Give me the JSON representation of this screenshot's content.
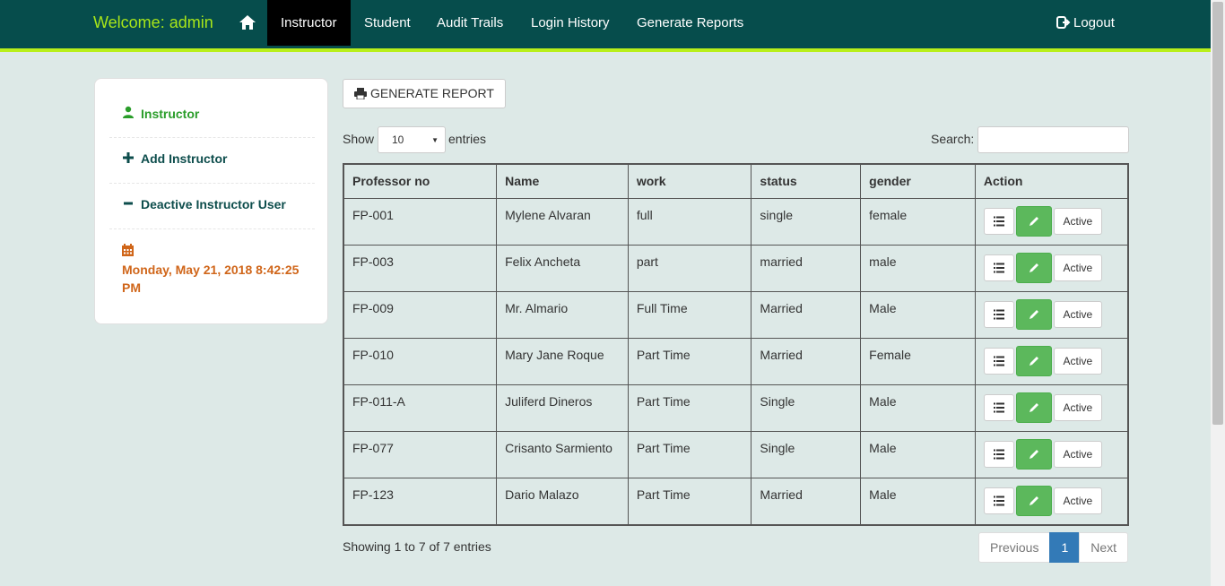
{
  "navbar": {
    "brand": "Welcome: admin",
    "items": [
      {
        "label": "Instructor",
        "active": true
      },
      {
        "label": "Student"
      },
      {
        "label": "Audit Trails"
      },
      {
        "label": "Login History"
      },
      {
        "label": "Generate Reports"
      }
    ],
    "logout": "Logout"
  },
  "sidebar": {
    "title": "Instructor",
    "add": "Add Instructor",
    "deactive": "Deactive Instructor User",
    "datetime": "Monday, May 21, 2018 8:42:25 PM"
  },
  "toolbar": {
    "generate": "GENERATE REPORT",
    "show": "Show",
    "entries_value": "10",
    "entries": "entries",
    "search": "Search:"
  },
  "table": {
    "headers": [
      "Professor no",
      "Name",
      "work",
      "status",
      "gender",
      "Action"
    ],
    "rows": [
      [
        "FP-001",
        "Mylene Alvaran",
        "full",
        "single",
        "female"
      ],
      [
        "FP-003",
        "Felix Ancheta",
        "part",
        "married",
        "male"
      ],
      [
        "FP-009",
        "Mr. Almario",
        "Full Time",
        "Married",
        "Male"
      ],
      [
        "FP-010",
        "Mary Jane Roque",
        "Part Time",
        "Married",
        "Female"
      ],
      [
        "FP-011-A",
        "Juliferd Dineros",
        "Part Time",
        "Single",
        "Male"
      ],
      [
        "FP-077",
        "Crisanto Sarmiento",
        "Part Time",
        "Single",
        "Male"
      ],
      [
        "FP-123",
        "Dario Malazo",
        "Part Time",
        "Married",
        "Male"
      ]
    ],
    "active_label": "Active"
  },
  "footer": {
    "info": "Showing 1 to 7 of 7 entries",
    "previous": "Previous",
    "page": "1",
    "next": "Next"
  },
  "colors": {
    "navbar": "#064d4c",
    "brand": "#a8e619",
    "accent_bar": "#b8ef1a",
    "edit_button": "#5cb85c",
    "date_text": "#d0661a"
  }
}
